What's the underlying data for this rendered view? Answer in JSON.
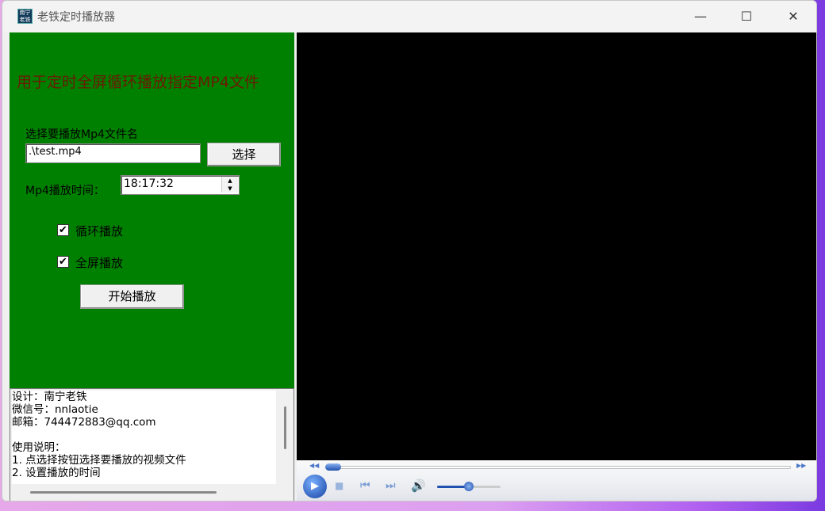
{
  "window": {
    "title": "老铁定时播放器",
    "app_icon_text": "南宁老铁",
    "minimize": "—",
    "maximize": "☐",
    "close": "✕"
  },
  "panel": {
    "heading": "用于定时全屏循环播放指定MP4文件",
    "file_label": "选择要播放Mp4文件名",
    "file_value": ".\\test.mp4",
    "choose_button": "选择",
    "time_label": "Mp4播放时间：",
    "time_value": "18:17:32",
    "loop_label": "循环播放",
    "loop_checked": true,
    "fullscreen_label": "全屏播放",
    "fullscreen_checked": true,
    "start_button": "开始播放",
    "background_color": "#008000",
    "heading_color": "#6b1a00"
  },
  "memo": {
    "lines": [
      "设计：南宁老铁",
      "微信号：nnlaotie",
      "邮箱：744472883@qq.com",
      "",
      "使用说明：",
      "1. 点选择按钮选择要播放的视频文件",
      "2. 设置播放的时间"
    ]
  },
  "player": {
    "progress": 0.0,
    "volume": 0.5
  }
}
